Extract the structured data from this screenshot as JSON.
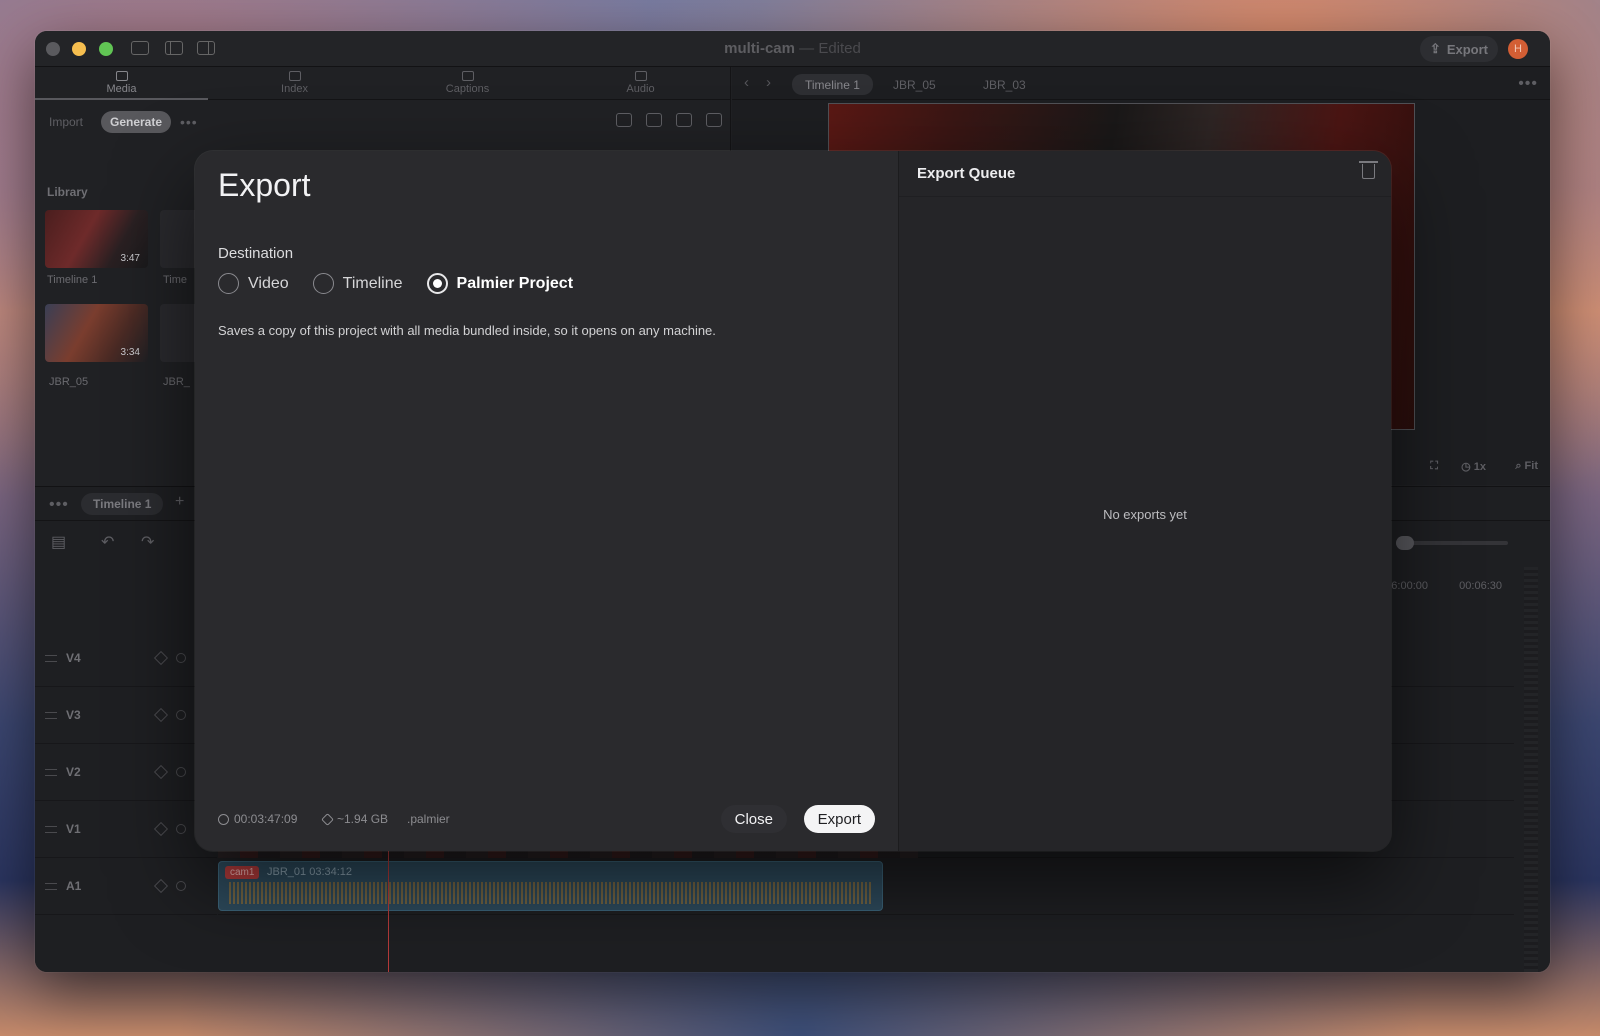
{
  "window": {
    "title": "multi-cam",
    "title_separator": "—",
    "status": "Edited",
    "export_label": "Export",
    "avatar_initial": "H"
  },
  "media_panel": {
    "tabs": [
      {
        "label": "Media",
        "icon": "folder-icon",
        "active": true
      },
      {
        "label": "Index",
        "icon": "list-icon",
        "active": false
      },
      {
        "label": "Captions",
        "icon": "caption-icon",
        "active": false
      },
      {
        "label": "Audio",
        "icon": "waveform-icon",
        "active": false
      }
    ],
    "import_label": "Import",
    "generate_label": "Generate",
    "library_label": "Library",
    "items": [
      {
        "name": "Timeline 1",
        "duration": "3:47"
      },
      {
        "name": "Time"
      },
      {
        "name": "JBR_05",
        "duration": "3:34"
      },
      {
        "name": "JBR_"
      }
    ]
  },
  "viewer": {
    "tabs": [
      "Timeline 1",
      "JBR_05",
      "JBR_03"
    ],
    "speed": "1x",
    "zoom": "Fit"
  },
  "timeline": {
    "tab": "Timeline 1",
    "ruler": [
      "6:00:00",
      "00:06:30"
    ],
    "tracks": [
      "V4",
      "V3",
      "V2",
      "V1",
      "A1"
    ],
    "clip": {
      "cam": "cam1",
      "name": "JBR_01",
      "timecode": "03:34:12"
    }
  },
  "export_dialog": {
    "title": "Export",
    "destination_label": "Destination",
    "options": [
      {
        "label": "Video",
        "selected": false
      },
      {
        "label": "Timeline",
        "selected": false
      },
      {
        "label": "Palmier Project",
        "selected": true
      }
    ],
    "description": "Saves a copy of this project with all media bundled inside, so it opens on any machine.",
    "duration": "00:03:47:09",
    "size": "~1.94 GB",
    "extension": ".palmier",
    "close_label": "Close",
    "export_label": "Export",
    "queue_title": "Export Queue",
    "queue_empty": "No exports yet"
  }
}
